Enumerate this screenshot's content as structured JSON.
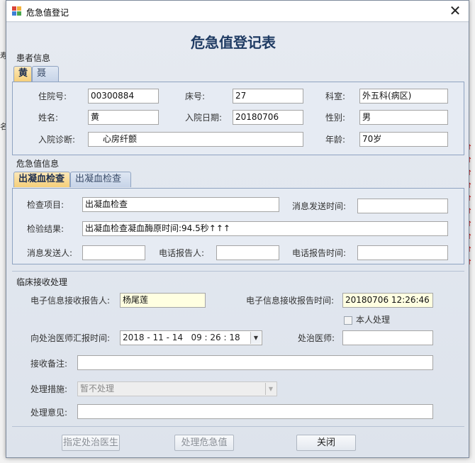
{
  "window": {
    "title": "危急值登记"
  },
  "form_title": "危急值登记表",
  "patient_section": {
    "label": "患者信息",
    "tabs": [
      "黄",
      "聂"
    ],
    "fields": {
      "admission_no_label": "住院号:",
      "admission_no": "00300884",
      "bed_label": "床号:",
      "bed": "27",
      "dept_label": "科室:",
      "dept": "外五科(病区)",
      "name_label": "姓名:",
      "name": "黄",
      "admit_date_label": "入院日期:",
      "admit_date": "20180706",
      "sex_label": "性别:",
      "sex": "男",
      "diagnosis_label": "入院诊断:",
      "diagnosis": "心房纤颤",
      "age_label": "年龄:",
      "age": "70岁"
    }
  },
  "critical_section": {
    "label": "危急值信息",
    "tabs": [
      "出凝血检查",
      "出凝血检查"
    ],
    "fields": {
      "item_label": "检查项目:",
      "item": "出凝血检查",
      "send_time_label": "消息发送时间:",
      "send_time": "",
      "result_label": "检验结果:",
      "result": "出凝血检查凝血酶原时间:94.5秒↑↑↑",
      "sender_label": "消息发送人:",
      "sender": "",
      "phone_reporter_label": "电话报告人:",
      "phone_reporter": "",
      "phone_time_label": "电话报告时间:",
      "phone_time": ""
    }
  },
  "clinical_section": {
    "label": "临床接收处理",
    "receiver_label": "电子信息接收报告人:",
    "receiver": "杨尾莲",
    "receive_time_label": "电子信息接收报告时间:",
    "receive_time": "20180706 12:26:46",
    "self_handle_label": "本人处理",
    "report_time_label": "向处治医师汇报时间:",
    "report_time": "2018 - 11 - 14   09 : 26 : 18",
    "doctor_label": "处治医师:",
    "doctor": "",
    "remark_label": "接收备注:",
    "remark": "",
    "measure_label": "处理措施:",
    "measure": "暂不处理",
    "opinion_label": "处理意见:",
    "opinion": ""
  },
  "buttons": {
    "assign_doctor": "指定处治医生",
    "handle_critical": "处理危急值",
    "close": "关闭"
  }
}
